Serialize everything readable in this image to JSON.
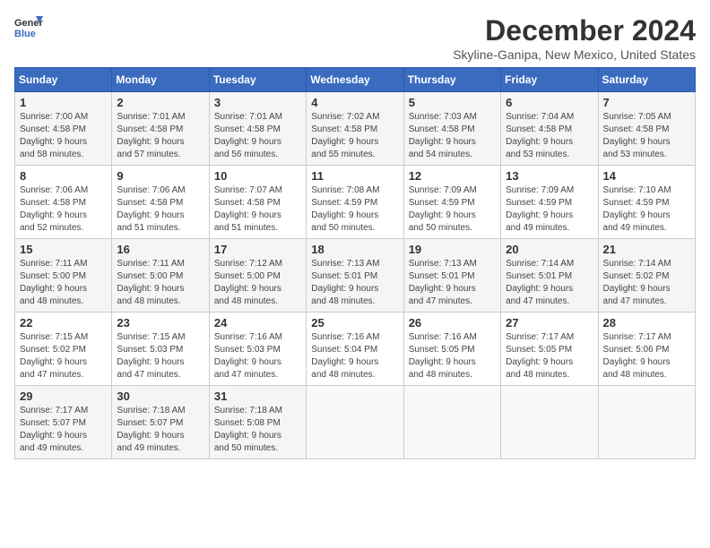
{
  "logo": {
    "line1": "General",
    "line2": "Blue"
  },
  "title": "December 2024",
  "location": "Skyline-Ganipa, New Mexico, United States",
  "days_of_week": [
    "Sunday",
    "Monday",
    "Tuesday",
    "Wednesday",
    "Thursday",
    "Friday",
    "Saturday"
  ],
  "weeks": [
    [
      {
        "day": "1",
        "info": "Sunrise: 7:00 AM\nSunset: 4:58 PM\nDaylight: 9 hours\nand 58 minutes."
      },
      {
        "day": "2",
        "info": "Sunrise: 7:01 AM\nSunset: 4:58 PM\nDaylight: 9 hours\nand 57 minutes."
      },
      {
        "day": "3",
        "info": "Sunrise: 7:01 AM\nSunset: 4:58 PM\nDaylight: 9 hours\nand 56 minutes."
      },
      {
        "day": "4",
        "info": "Sunrise: 7:02 AM\nSunset: 4:58 PM\nDaylight: 9 hours\nand 55 minutes."
      },
      {
        "day": "5",
        "info": "Sunrise: 7:03 AM\nSunset: 4:58 PM\nDaylight: 9 hours\nand 54 minutes."
      },
      {
        "day": "6",
        "info": "Sunrise: 7:04 AM\nSunset: 4:58 PM\nDaylight: 9 hours\nand 53 minutes."
      },
      {
        "day": "7",
        "info": "Sunrise: 7:05 AM\nSunset: 4:58 PM\nDaylight: 9 hours\nand 53 minutes."
      }
    ],
    [
      {
        "day": "8",
        "info": "Sunrise: 7:06 AM\nSunset: 4:58 PM\nDaylight: 9 hours\nand 52 minutes."
      },
      {
        "day": "9",
        "info": "Sunrise: 7:06 AM\nSunset: 4:58 PM\nDaylight: 9 hours\nand 51 minutes."
      },
      {
        "day": "10",
        "info": "Sunrise: 7:07 AM\nSunset: 4:58 PM\nDaylight: 9 hours\nand 51 minutes."
      },
      {
        "day": "11",
        "info": "Sunrise: 7:08 AM\nSunset: 4:59 PM\nDaylight: 9 hours\nand 50 minutes."
      },
      {
        "day": "12",
        "info": "Sunrise: 7:09 AM\nSunset: 4:59 PM\nDaylight: 9 hours\nand 50 minutes."
      },
      {
        "day": "13",
        "info": "Sunrise: 7:09 AM\nSunset: 4:59 PM\nDaylight: 9 hours\nand 49 minutes."
      },
      {
        "day": "14",
        "info": "Sunrise: 7:10 AM\nSunset: 4:59 PM\nDaylight: 9 hours\nand 49 minutes."
      }
    ],
    [
      {
        "day": "15",
        "info": "Sunrise: 7:11 AM\nSunset: 5:00 PM\nDaylight: 9 hours\nand 48 minutes."
      },
      {
        "day": "16",
        "info": "Sunrise: 7:11 AM\nSunset: 5:00 PM\nDaylight: 9 hours\nand 48 minutes."
      },
      {
        "day": "17",
        "info": "Sunrise: 7:12 AM\nSunset: 5:00 PM\nDaylight: 9 hours\nand 48 minutes."
      },
      {
        "day": "18",
        "info": "Sunrise: 7:13 AM\nSunset: 5:01 PM\nDaylight: 9 hours\nand 48 minutes."
      },
      {
        "day": "19",
        "info": "Sunrise: 7:13 AM\nSunset: 5:01 PM\nDaylight: 9 hours\nand 47 minutes."
      },
      {
        "day": "20",
        "info": "Sunrise: 7:14 AM\nSunset: 5:01 PM\nDaylight: 9 hours\nand 47 minutes."
      },
      {
        "day": "21",
        "info": "Sunrise: 7:14 AM\nSunset: 5:02 PM\nDaylight: 9 hours\nand 47 minutes."
      }
    ],
    [
      {
        "day": "22",
        "info": "Sunrise: 7:15 AM\nSunset: 5:02 PM\nDaylight: 9 hours\nand 47 minutes."
      },
      {
        "day": "23",
        "info": "Sunrise: 7:15 AM\nSunset: 5:03 PM\nDaylight: 9 hours\nand 47 minutes."
      },
      {
        "day": "24",
        "info": "Sunrise: 7:16 AM\nSunset: 5:03 PM\nDaylight: 9 hours\nand 47 minutes."
      },
      {
        "day": "25",
        "info": "Sunrise: 7:16 AM\nSunset: 5:04 PM\nDaylight: 9 hours\nand 48 minutes."
      },
      {
        "day": "26",
        "info": "Sunrise: 7:16 AM\nSunset: 5:05 PM\nDaylight: 9 hours\nand 48 minutes."
      },
      {
        "day": "27",
        "info": "Sunrise: 7:17 AM\nSunset: 5:05 PM\nDaylight: 9 hours\nand 48 minutes."
      },
      {
        "day": "28",
        "info": "Sunrise: 7:17 AM\nSunset: 5:06 PM\nDaylight: 9 hours\nand 48 minutes."
      }
    ],
    [
      {
        "day": "29",
        "info": "Sunrise: 7:17 AM\nSunset: 5:07 PM\nDaylight: 9 hours\nand 49 minutes."
      },
      {
        "day": "30",
        "info": "Sunrise: 7:18 AM\nSunset: 5:07 PM\nDaylight: 9 hours\nand 49 minutes."
      },
      {
        "day": "31",
        "info": "Sunrise: 7:18 AM\nSunset: 5:08 PM\nDaylight: 9 hours\nand 50 minutes."
      },
      {
        "day": "",
        "info": ""
      },
      {
        "day": "",
        "info": ""
      },
      {
        "day": "",
        "info": ""
      },
      {
        "day": "",
        "info": ""
      }
    ]
  ]
}
